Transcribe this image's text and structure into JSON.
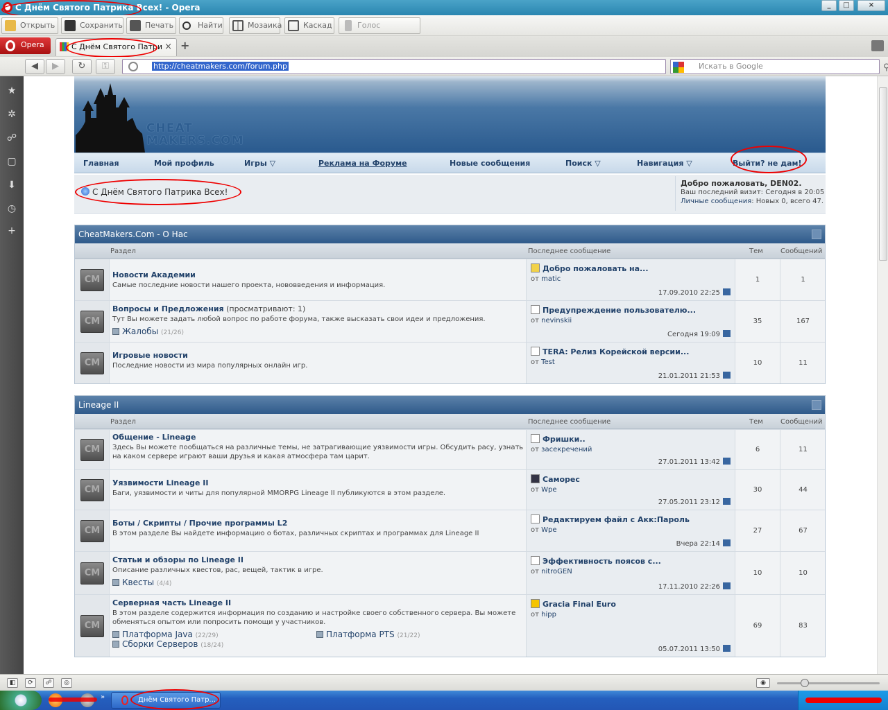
{
  "window": {
    "title": "С Днём Святого Патрика Всех! - Opera",
    "controls": [
      "_",
      "□",
      "×"
    ]
  },
  "toolbar": {
    "open": "Открыть",
    "save": "Сохранить",
    "print": "Печать",
    "find": "Найти",
    "tile": "Мозаика",
    "cascade": "Каскад",
    "voice": "Голос"
  },
  "tabs": {
    "menu_label": "Opera",
    "active_tab": "С Днём Святого Патри",
    "new_tab": "+"
  },
  "address": {
    "url": "http://cheatmakers.com/forum.php",
    "search_placeholder": "Искать в Google"
  },
  "site": {
    "logo_line1": "CHEAT",
    "logo_line2": "MAKERS.COM",
    "nav": [
      {
        "label": "Главная"
      },
      {
        "label": "Мой профиль"
      },
      {
        "label": "Игры ▽"
      },
      {
        "label": "Реклама на Форуме"
      },
      {
        "label": "Новые сообщения"
      },
      {
        "label": "Поиск ▽"
      },
      {
        "label": "Навигация ▽"
      },
      {
        "label": "Выйти? не дам!"
      }
    ],
    "notice": "С Днём Святого Патрика Всех!",
    "welcome": {
      "greeting": "Добро пожаловать, DEN02.",
      "last_visit": "Ваш последний визит: Сегодня в 20:05",
      "pm_link": "Личные сообщения",
      "pm_counts": ": Новых 0, всего 47."
    }
  },
  "columns": {
    "forum": "Раздел",
    "last_post": "Последнее сообщение",
    "threads": "Тем",
    "posts": "Сообщений"
  },
  "categories": [
    {
      "title": "CheatMakers.Com - О Нас",
      "forums": [
        {
          "title": "Новости Академии",
          "viewing": "",
          "desc": "Самые последние новости нашего проекта, нововведения и информация.",
          "subforums": [],
          "last_title": "Добро пожаловать на...",
          "last_by": "matic",
          "last_date": "17.09.2010 22:25",
          "threads": "1",
          "posts": "1"
        },
        {
          "title": "Вопросы и Предложения",
          "viewing": " (просматривают: 1)",
          "desc": "Тут Вы можете задать любой вопрос по работе форума, также высказать свои идеи и предложения.",
          "subforums": [
            {
              "name": "Жалобы",
              "count": "(21/26)"
            }
          ],
          "last_title": "Предупреждение пользователю...",
          "last_by": "nevinskii",
          "last_date": "Сегодня 19:09",
          "threads": "35",
          "posts": "167"
        },
        {
          "title": "Игровые новости",
          "viewing": "",
          "desc": "Последние новости из мира популярных онлайн игр.",
          "subforums": [],
          "last_title": "TERA: Релиз Корейской версии...",
          "last_by": "Test",
          "last_date": "21.01.2011 21:53",
          "threads": "10",
          "posts": "11"
        }
      ]
    },
    {
      "title": "Lineage II",
      "forums": [
        {
          "title": "Общение - Lineage",
          "viewing": "",
          "desc": "Здесь Вы можете пообщаться на различные темы, не затрагивающие уязвимости игры. Обсудить расу, узнать на каком сервере играют ваши друзья и какая атмосфера там царит.",
          "subforums": [],
          "last_title": "Фришки..",
          "last_by": "засекречений",
          "last_date": "27.01.2011 13:42",
          "threads": "6",
          "posts": "11"
        },
        {
          "title": "Уязвимости Lineage II",
          "viewing": "",
          "desc": "Баги, уязвимости и читы для популярной MMORPG Lineage II публикуются в этом разделе.",
          "subforums": [],
          "last_title": "Саморес",
          "last_by": "Wpe",
          "last_date": "27.05.2011 23:12",
          "threads": "30",
          "posts": "44"
        },
        {
          "title": "Боты / Скрипты / Прочие программы L2",
          "viewing": "",
          "desc": "В этом разделе Вы найдете информацию о ботах, различных скриптах и программах для Lineage II",
          "subforums": [],
          "last_title": "Редактируем файл с Акк:Пароль",
          "last_by": "Wpe",
          "last_date": "Вчера 22:14",
          "threads": "27",
          "posts": "67"
        },
        {
          "title": "Статьи и обзоры по Lineage II",
          "viewing": "",
          "desc": "Описание различных квестов, рас, вещей, тактик в игре.",
          "subforums": [
            {
              "name": "Квесты",
              "count": "(4/4)"
            }
          ],
          "last_title": "Эффективность поясов с...",
          "last_by": "nitroGEN",
          "last_date": "17.11.2010 22:26",
          "threads": "10",
          "posts": "10"
        },
        {
          "title": "Серверная часть Lineage II",
          "viewing": "",
          "desc": "В этом разделе содержится информация по созданию и настройке своего собственного сервера. Вы можете обменяться опытом или попросить помощи у участников.",
          "subforums": [
            {
              "name": "Платформа Java",
              "count": "(22/29)"
            },
            {
              "name": "Платформа PTS",
              "count": "(21/22)"
            },
            {
              "name": "Сборки Серверов",
              "count": "(18/24)"
            }
          ],
          "last_title": "Gracia Final Euro",
          "last_by": "hipp",
          "last_date": "05.07.2011 13:50",
          "threads": "69",
          "posts": "83"
        }
      ]
    }
  ],
  "last_post_prefix": "от ",
  "taskbar": {
    "item": "Днём Святого Патр...",
    "quick_launch_more": "»"
  }
}
